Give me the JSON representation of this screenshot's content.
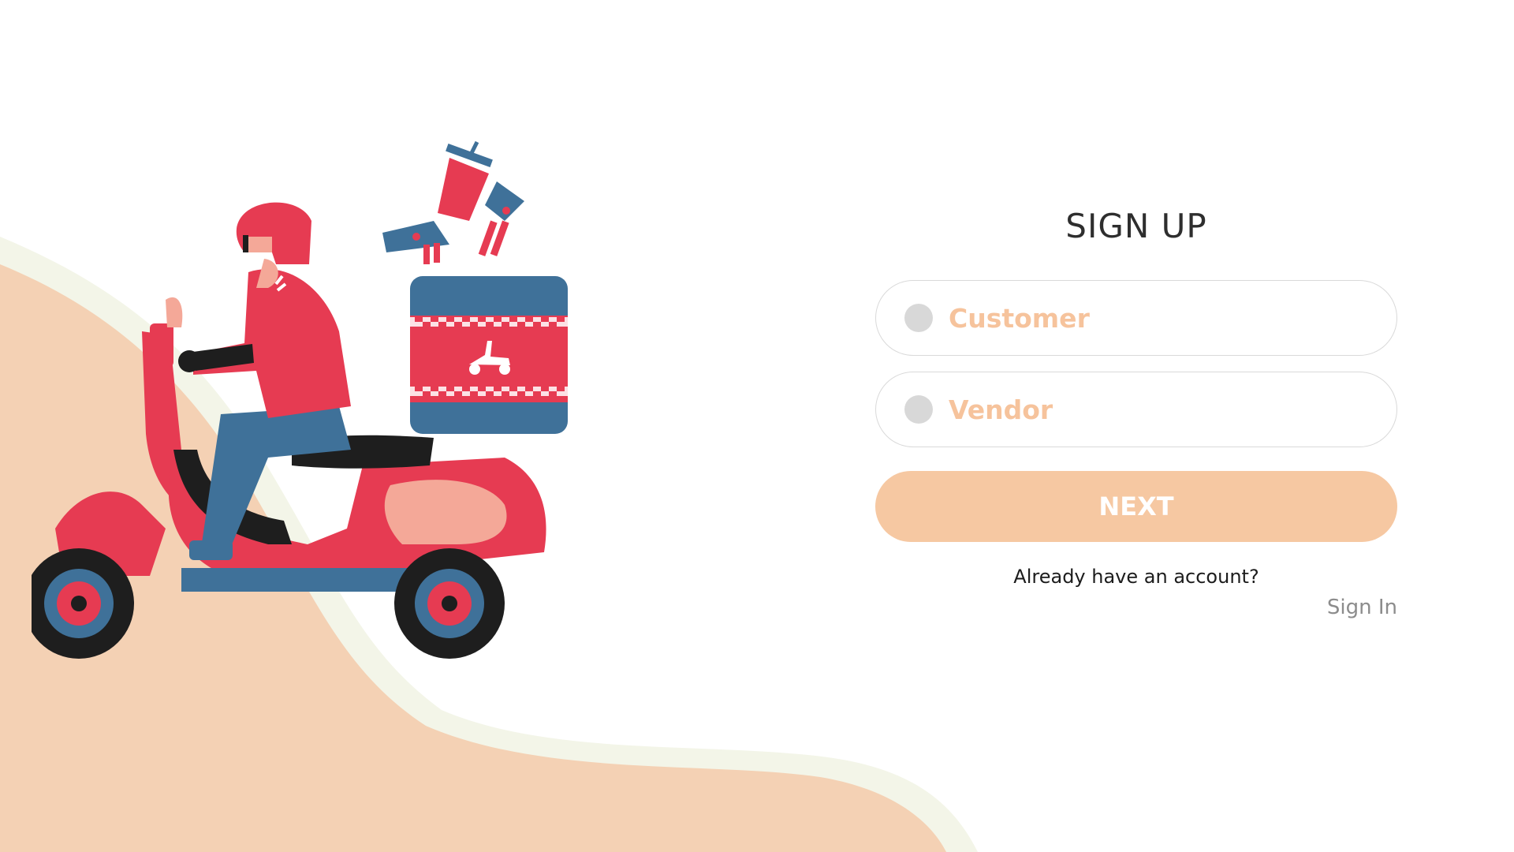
{
  "form": {
    "title": "SIGN UP",
    "options": [
      {
        "label": "Customer",
        "selected": false
      },
      {
        "label": "Vendor",
        "selected": false
      }
    ],
    "next_label": "NEXT",
    "account_prompt": "Already have an account?",
    "signin_label": "Sign In"
  },
  "colors": {
    "accent": "#f6c8a2",
    "option_text": "#f6c39c",
    "background_wave": "#f4d1b4",
    "wave_edge": "#f3f5e8",
    "scooter_red": "#e63b52",
    "scooter_blue": "#3f7199"
  },
  "illustration": {
    "subject": "delivery-rider-on-scooter"
  }
}
